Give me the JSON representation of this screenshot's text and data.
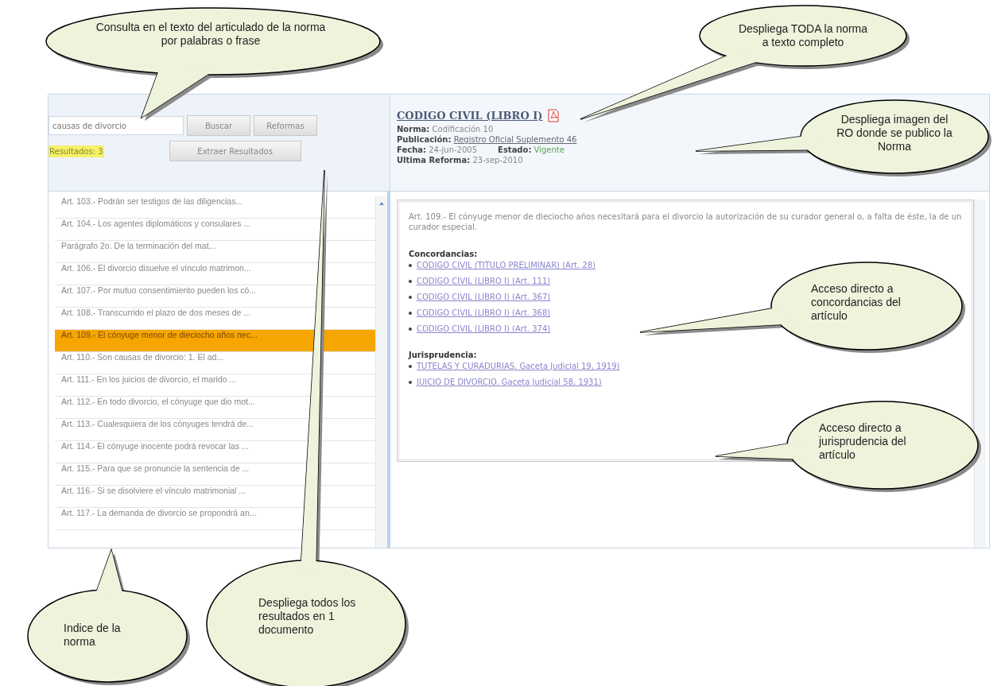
{
  "search": {
    "value": "causas de divorcio"
  },
  "buttons": [
    "Buscar",
    "Reformas"
  ],
  "results": "Resultados: 3",
  "extract_button": "Extraer Resultados",
  "norma": {
    "title": "CODIGO CIVIL (LIBRO I)",
    "rows": [
      [
        {
          "label": "Norma:",
          "value": "Codificación 10",
          "kind": "text"
        }
      ],
      [
        {
          "label": "Publicación:",
          "value": "Registro Oficial Suplemento 46",
          "kind": "link"
        }
      ],
      [
        {
          "label": "Fecha:",
          "value": "24-jun-2005",
          "kind": "text"
        },
        {
          "label": "Estado:",
          "value": "Vigente",
          "kind": "status"
        }
      ],
      [
        {
          "label": "Ultima Reforma:",
          "value": "23-sep-2010",
          "kind": "text"
        }
      ]
    ]
  },
  "index": [
    {
      "label": "Art. 103.- Podrán ser testigos de las diligencias...",
      "selected": false
    },
    {
      "label": "Art. 104.- Los agentes diplomáticos y consulares ...",
      "selected": false
    },
    {
      "label": "Parágrafo 2o. De la terminación del mat...",
      "selected": false
    },
    {
      "label": "Art. 106.- El divorcio disuelve el vínculo matrimon...",
      "selected": false
    },
    {
      "label": "Art. 107.- Por mutuo consentimiento pueden los có...",
      "selected": false
    },
    {
      "label": "Art. 108.- Transcurrido el plazo de dos meses de ...",
      "selected": false
    },
    {
      "label": "Art. 109.- El cónyuge menor de dieciocho años nec...",
      "selected": true
    },
    {
      "label": "Art. 110.- Son causas de divorcio: 1. El ad...",
      "selected": false
    },
    {
      "label": "Art. 111.- En los juicios de divorcio, el marido ...",
      "selected": false
    },
    {
      "label": "Art. 112.- En todo divorcio, el cónyuge que dio mot...",
      "selected": false
    },
    {
      "label": "Art. 113.- Cualesquiera de los cónyuges tendrá de...",
      "selected": false
    },
    {
      "label": "Art. 114.- El cónyuge inocente podrá revocar las ...",
      "selected": false
    },
    {
      "label": "Art. 115.- Para que se pronuncie la sentencia de ...",
      "selected": false
    },
    {
      "label": "Art. 116.- Si se disolviere el vínculo matrimonial ...",
      "selected": false
    },
    {
      "label": "Art. 117.- La demanda de divorcio se propondrá an...",
      "selected": false
    }
  ],
  "article": {
    "text": "Art. 109.- El cónyuge menor de dieciocho años necesitará para el divorcio la autorización de su curador general o, a falta de éste, la de un curador especial.",
    "sections": [
      {
        "heading": "Concordancias:",
        "links": [
          "CODIGO CIVIL (TITULO PRELIMINAR) (Art. 28)",
          "CODIGO CIVIL (LIBRO I) (Art. 111)",
          "CODIGO CIVIL (LIBRO I) (Art. 367)",
          "CODIGO CIVIL (LIBRO I) (Art. 368)",
          "CODIGO CIVIL (LIBRO I) (Art. 374)"
        ]
      },
      {
        "heading": "Jurisprudencia:",
        "links": [
          "TUTELAS Y CURADURIAS. Gaceta Judicial 19, 1919)",
          "JUICIO DE DIVORCIO. Gaceta Judicial 58, 1931)"
        ]
      }
    ]
  },
  "callouts": [
    {
      "text": "Consulta en el texto del articulado de la norma por palabras o frase"
    },
    {
      "text": "Despliega TODA la norma a texto completo"
    },
    {
      "text": "Despliega imagen del RO donde se publico la Norma"
    },
    {
      "text": "Acceso directo a concordancias del artículo"
    },
    {
      "text": "Acceso directo a jurisprudencia del artículo"
    },
    {
      "text": "Indice de la norma"
    },
    {
      "text": "Despliega todos los resultados en 1 documento"
    }
  ]
}
